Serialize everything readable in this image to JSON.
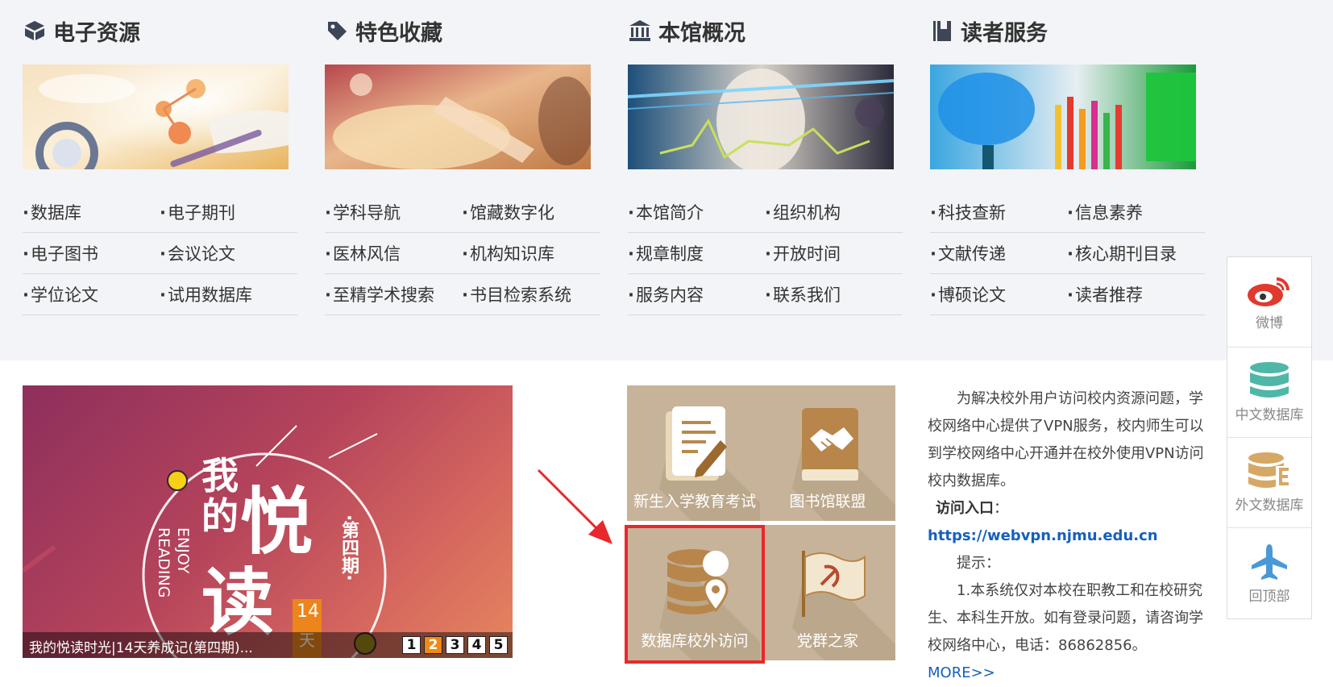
{
  "columns": [
    {
      "title": "电子资源",
      "icon": "box-icon",
      "links": [
        [
          "数据库",
          "电子期刊"
        ],
        [
          "电子图书",
          "会议论文"
        ],
        [
          "学位论文",
          "试用数据库"
        ]
      ]
    },
    {
      "title": "特色收藏",
      "icon": "tag-icon",
      "links": [
        [
          "学科导航",
          "馆藏数字化"
        ],
        [
          "医林风信",
          "机构知识库"
        ],
        [
          "至精学术搜索",
          "书目检索系统"
        ]
      ]
    },
    {
      "title": "本馆概况",
      "icon": "library-building-icon",
      "links": [
        [
          "本馆简介",
          "组织机构"
        ],
        [
          "规章制度",
          "开放时间"
        ],
        [
          "服务内容",
          "联系我们"
        ]
      ]
    },
    {
      "title": "读者服务",
      "icon": "book-icon",
      "links": [
        [
          "科技查新",
          "信息素养"
        ],
        [
          "文献传递",
          "核心期刊目录"
        ],
        [
          "博硕论文",
          "读者推荐"
        ]
      ]
    }
  ],
  "banner": {
    "caption": "我的悦读时光|14天养成记(第四期)...",
    "art_text": {
      "wo": "我",
      "de": "的",
      "yue": "悦",
      "du": "读",
      "issue": "·第四期·",
      "enjoy": "ENJOY",
      "reading": "READING",
      "days_num": "14",
      "days_unit": "天"
    },
    "pages": [
      "1",
      "2",
      "3",
      "4",
      "5"
    ],
    "active_page": "2"
  },
  "tiles": [
    {
      "label": "新生入学教育考试",
      "icon": "exam-paper-icon"
    },
    {
      "label": "图书馆联盟",
      "icon": "handshake-book-icon"
    },
    {
      "label": "数据库校外访问",
      "icon": "database-location-icon"
    },
    {
      "label": "党群之家",
      "icon": "party-flag-icon"
    }
  ],
  "info": {
    "intro": "为解决校外用户访问校内资源问题，学校网络中心提供了VPN服务，校内师生可以到学校网络中心开通并在校外使用VPN访问校内数据库。",
    "entry_label": "访问入口",
    "entry_colon": "：",
    "url": "https://webvpn.njmu.edu.cn",
    "tip_label": "提示：",
    "tip_text": "1.本系统仅对本校在职教工和在校研究生、本科生开放。如有登录问题，请咨询学校网络中心，电话：86862856。",
    "more": "MORE>>"
  },
  "sidebar": [
    {
      "label": "微博",
      "icon": "weibo-icon"
    },
    {
      "label": "中文数据库",
      "icon": "database-icon"
    },
    {
      "label": "外文数据库",
      "icon": "database-e-icon"
    },
    {
      "label": "回顶部",
      "icon": "airplane-icon"
    }
  ],
  "colors": {
    "top_bg": "#f3f4f7",
    "tile_bg": "#c7b39a",
    "highlight": "#e8282c",
    "link_blue": "#1560bd",
    "active_page": "#f08a14"
  }
}
